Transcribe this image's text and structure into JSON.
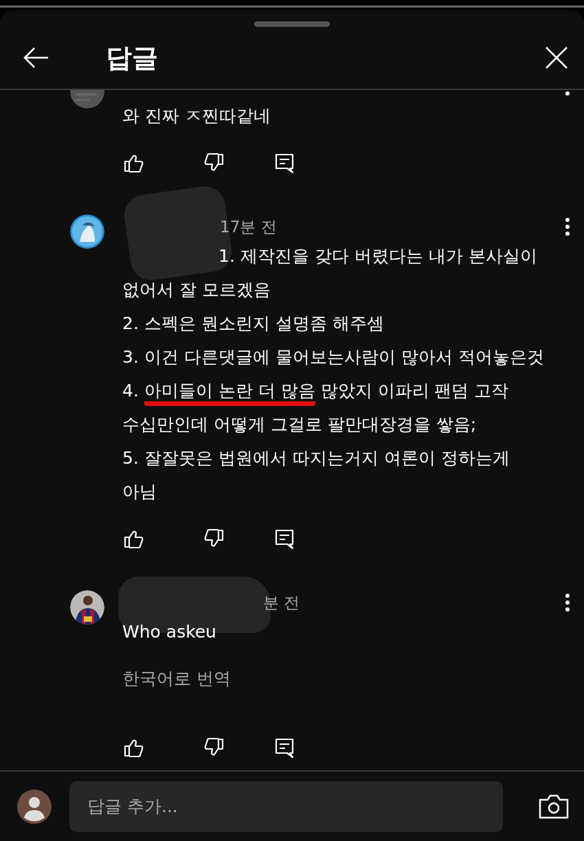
{
  "header": {
    "title": "답글"
  },
  "comments": [
    {
      "lines": [
        [
          "와 진짜 ㅈ찐따같네"
        ]
      ]
    },
    {
      "time": "17분 전",
      "redacted": true,
      "indent_first": true,
      "lines": [
        [
          "1. 제작진을 갖다 버렸다는 내가 본사실이"
        ],
        [
          "없어서 잘 모르겠음"
        ],
        [
          "2. 스펙은 뭔소린지 설명좀 해주셈"
        ],
        [
          "3. 이건 다른댓글에 물어보는사람이 많아서 적어놓은것"
        ],
        [
          "4. ",
          {
            "text": "아미들이 논란 더 많음",
            "underlined": true
          },
          " 많았지 이파리 팬덤 고작"
        ],
        [
          "수십만인데 어떻게 그걸로 팔만대장경을 쌓음;"
        ],
        [
          "5. 잘잘못은 법원에서 따지는거지 여론이 정하는게"
        ],
        [
          "아님"
        ]
      ]
    },
    {
      "time": "분 전",
      "redacted": true,
      "lines": [
        [
          "Who askeu"
        ]
      ],
      "translate": "한국어로 번역"
    }
  ],
  "reply_box": {
    "placeholder": "답글 추가..."
  }
}
